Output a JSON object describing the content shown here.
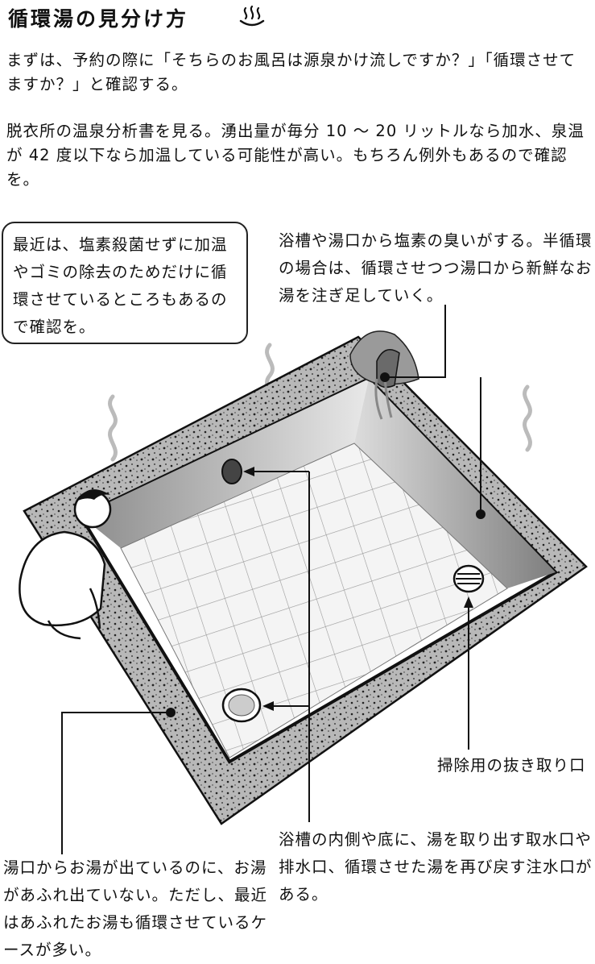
{
  "title": "循環湯の見分け方",
  "title_icon": "onsen-hot-spring-icon",
  "paragraphs": [
    "まずは、予約の際に「そちらのお風呂は源泉かけ流しですか？」「循環させてますか？」と確認する。",
    "脱衣所の温泉分析書を見る。湧出量が毎分 10 〜 20 リットルなら加水、泉温が 42 度以下なら加温している可能性が高い。もちろん例外もあるので確認を。"
  ],
  "callouts": {
    "recent_note": "最近は、塩素殺菌せずに加温やゴミの除去のためだけに循環させているところもあるので確認を。",
    "chlorine_note": "浴槽や湯口から塩素の臭いがする。半循環の場合は、循環させつつ湯口から新鮮なお湯を注ぎ足していく。",
    "drain_label": "掃除用の抜き取り口",
    "intake_note": "浴槽の内側や底に、湯を取り出す取水口や排水口、循環させた湯を再び戻す注水口がある。",
    "overflow_note": "湯口からお湯が出ているのに、お湯があふれ出ていない。ただし、最近はあふれたお湯も循環させているケースが多い。"
  }
}
